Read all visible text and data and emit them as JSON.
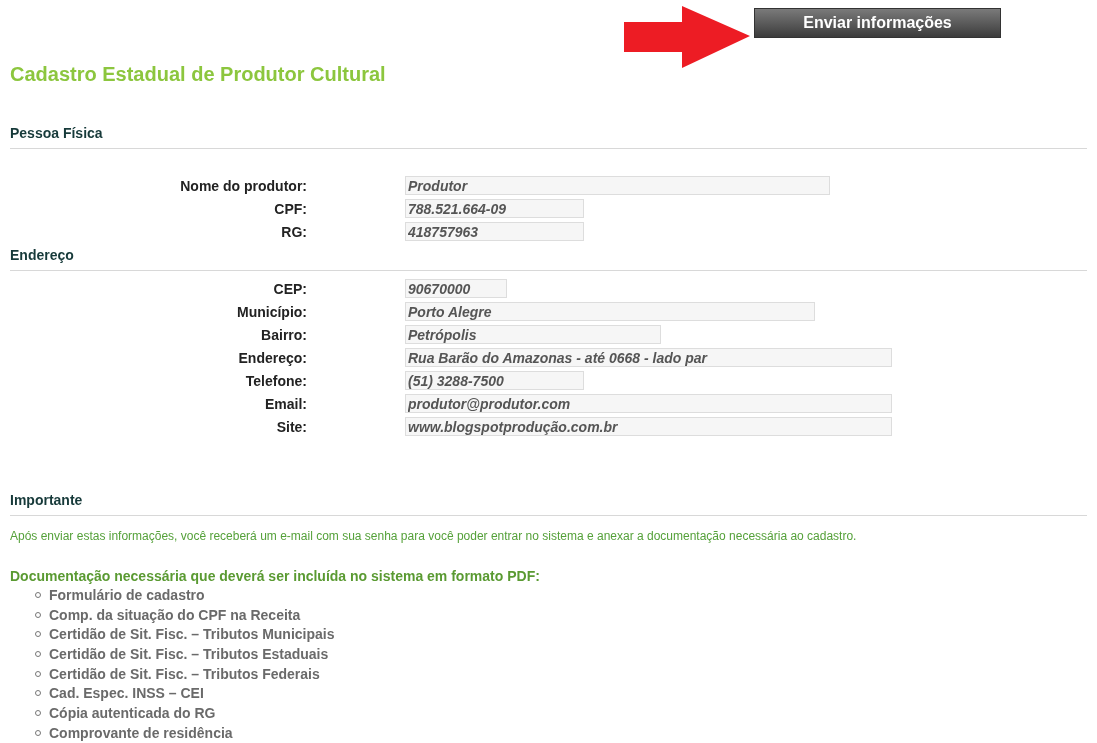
{
  "submit_button": {
    "label": "Enviar informações"
  },
  "title": "Cadastro Estadual de Produtor Cultural",
  "sections": [
    {
      "heading": "Pessoa Física",
      "fields": [
        {
          "label": "Nome do produtor:",
          "value": "Produtor"
        },
        {
          "label": "CPF:",
          "value": "788.521.664-09"
        },
        {
          "label": "RG:",
          "value": "418757963"
        }
      ]
    },
    {
      "heading": "Endereço",
      "fields": [
        {
          "label": "CEP:",
          "value": "90670000"
        },
        {
          "label": "Município:",
          "value": "Porto Alegre"
        },
        {
          "label": "Bairro:",
          "value": "Petrópolis"
        },
        {
          "label": "Endereço:",
          "value": "Rua Barão do Amazonas - até 0668 - lado par"
        },
        {
          "label": "Telefone:",
          "value": "(51) 3288-7500"
        },
        {
          "label": "Email:",
          "value": "produtor@produtor.com"
        },
        {
          "label": "Site:",
          "value": "www.blogspotprodução.com.br"
        }
      ]
    }
  ],
  "important": {
    "heading": "Importante",
    "notice": "Após enviar estas informações, você receberá um e-mail com sua senha para você poder entrar no sistema e anexar a documentação necessária ao cadastro.",
    "documents_heading": "Documentação necessária que deverá ser incluída no sistema em formato PDF:",
    "documents": [
      "Formulário de cadastro",
      "Comp. da situação do CPF na Receita",
      "Certidão de Sit. Fisc. – Tributos Municipais",
      "Certidão de Sit. Fisc. – Tributos Estaduais",
      "Certidão de Sit. Fisc. – Tributos Federais",
      "Cad. Espec. INSS – CEI",
      "Cópia autenticada do RG",
      "Comprovante de residência"
    ]
  }
}
